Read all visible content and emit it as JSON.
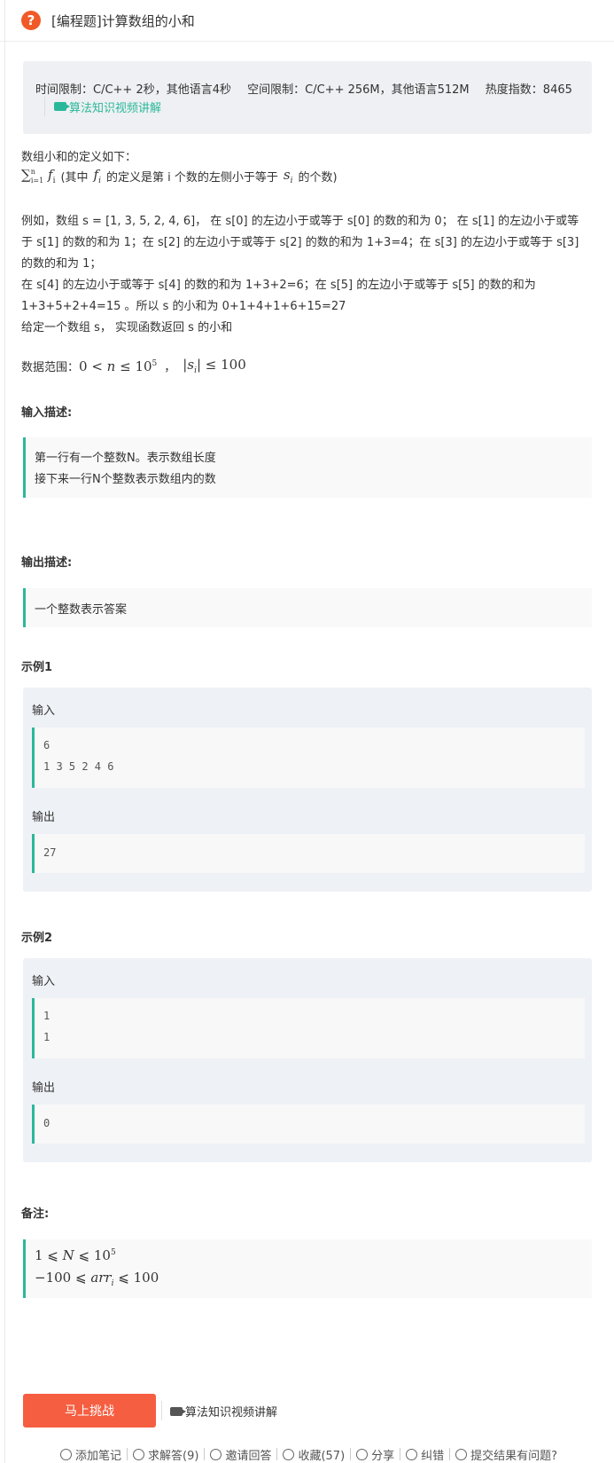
{
  "header": {
    "icon": "question-icon",
    "title": "[编程题]计算数组的小和"
  },
  "info": {
    "time_limit": "时间限制：C/C++ 2秒，其他语言4秒",
    "space_limit": "空间限制：C/C++ 256M，其他语言512M",
    "heat": "热度指数：8465",
    "video_link": "算法知识视频讲解"
  },
  "description": {
    "intro": "数组小和的定义如下：",
    "formula_tail_1": "(其中",
    "formula_tail_2": "的定义是第 i 个数的左侧小于等于",
    "formula_tail_3": "的个数)",
    "lines": [
      "例如，数组 s = [1, 3, 5, 2, 4, 6]， 在 s[0] 的左边小于或等于 s[0] 的数的和为 0； 在 s[1] 的左边小于或等",
      "于 s[1] 的数的和为 1；在 s[2] 的左边小于或等于 s[2] 的数的和为 1+3=4；在 s[3] 的左边小于或等于 s[3]",
      "的数的和为 1；",
      "在 s[4] 的左边小于或等于 s[4] 的数的和为 1+3+2=6；在 s[5] 的左边小于或等于 s[5] 的数的和为",
      "1+3+5+2+4=15 。所以 s 的小和为 0+1+4+1+6+15=27",
      "给定一个数组 s， 实现函数返回 s 的小和"
    ],
    "range_label": "数据范围："
  },
  "input_desc": {
    "heading": "输入描述:",
    "lines": [
      "第一行有一个整数N。表示数组长度",
      "接下来一行N个整数表示数组内的数"
    ]
  },
  "output_desc": {
    "heading": "输出描述:",
    "lines": [
      "一个整数表示答案"
    ]
  },
  "examples": [
    {
      "heading": "示例1",
      "input_label": "输入",
      "input_lines": [
        "6",
        "1 3 5 2 4 6"
      ],
      "output_label": "输出",
      "output_lines": [
        "27"
      ]
    },
    {
      "heading": "示例2",
      "input_label": "输入",
      "input_lines": [
        "1",
        "1"
      ],
      "output_label": "输出",
      "output_lines": [
        "0"
      ]
    }
  ],
  "notes": {
    "heading": "备注:"
  },
  "actions": {
    "challenge_button": "马上挑战",
    "video_link": "算法知识视频讲解"
  },
  "footer": {
    "items": [
      {
        "icon": "note-icon",
        "label": "添加笔记"
      },
      {
        "icon": "help-icon",
        "label": "求解答(9)"
      },
      {
        "icon": "invite-icon",
        "label": "邀请回答"
      },
      {
        "icon": "heart-icon",
        "label": "收藏(57)"
      },
      {
        "icon": "share-icon",
        "label": "分享"
      },
      {
        "icon": "edit-icon",
        "label": "纠错"
      },
      {
        "icon": "alert-icon",
        "label": "提交结果有问题?"
      }
    ]
  }
}
